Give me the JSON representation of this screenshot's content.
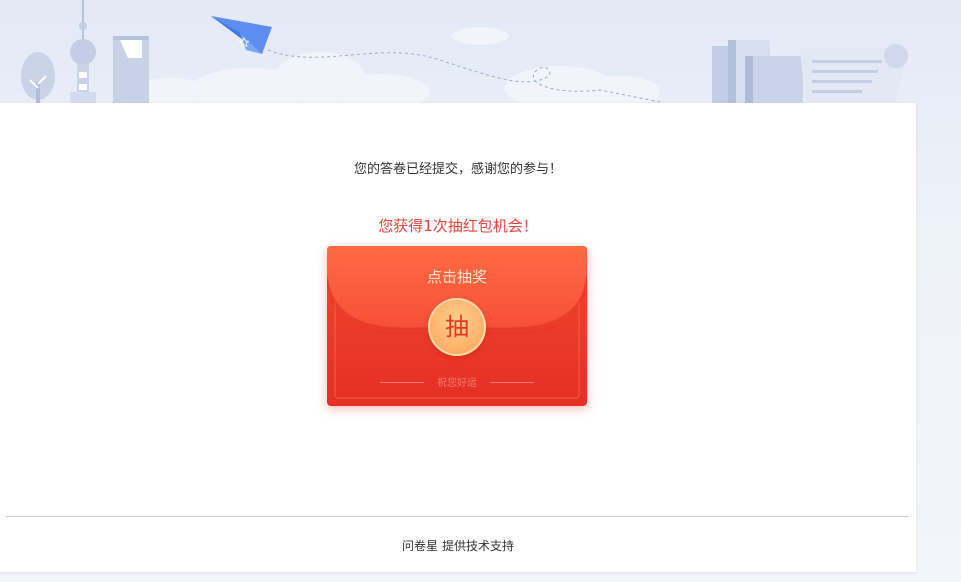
{
  "header": {
    "illustration": "city-skyline-paper-plane-books-banner"
  },
  "main": {
    "thanks_text": "您的答卷已经提交，感谢您的参与！",
    "chance_text": "您获得1次抽红包机会！"
  },
  "red_packet": {
    "title": "点击抽奖",
    "button_label": "抽",
    "wish_text": "祝您好运",
    "colors": {
      "body": "#ef3b2d",
      "flap": "#fb5e3c",
      "button": "#fdb36b",
      "title_text": "#ffe7c9"
    }
  },
  "footer": {
    "brand": "问卷星",
    "support_text": "提供技术支持"
  },
  "colors": {
    "accent_red": "#e8443b",
    "background": "#eef2f9"
  }
}
